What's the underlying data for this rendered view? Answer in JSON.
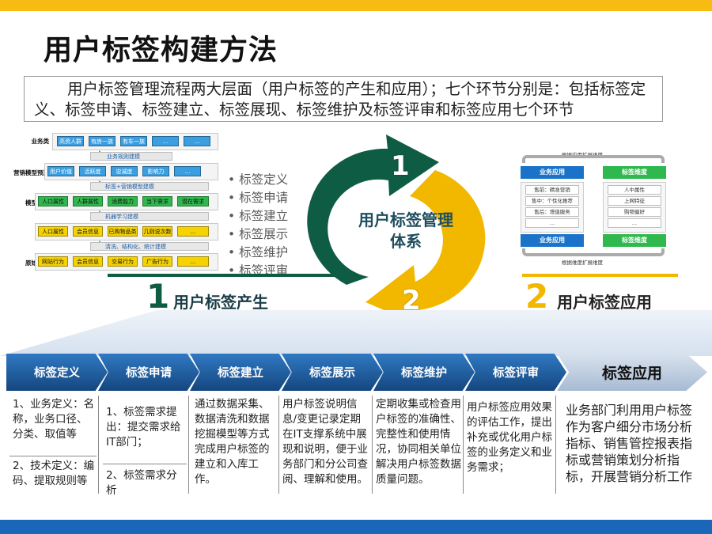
{
  "title": "用户标签构建方法",
  "intro": "用户标签管理流程两大层面（用户标签的产生和应用）；七个环节分别是：包括标签定义、标签申请、标签建立、标签展现、标签维护及标签评审和标签应用七个环节",
  "left_diagram": {
    "rows": [
      {
        "label": "业务类",
        "chips": [
          "高资人群",
          "有房一族",
          "有车一族",
          "...",
          "..."
        ],
        "color": "blue"
      },
      {
        "band": "业务规则建模"
      },
      {
        "label": "营销模型预测",
        "chips": [
          "用户价值",
          "活跃度",
          "忠诚度",
          "影响力",
          "..."
        ],
        "color": "blue"
      },
      {
        "band": "标签+营销模型建模"
      },
      {
        "label": "模型预测",
        "chips": [
          "人口属性",
          "人群属性",
          "消费能力",
          "当下需求",
          "潜在需求"
        ],
        "color": "green"
      },
      {
        "band": "机器学习建模"
      },
      {
        "label": "事实",
        "chips": [
          "人口属性",
          "会员信息",
          "已购物品类",
          "几则说次数",
          "..."
        ],
        "color": "yellow"
      },
      {
        "band": "清洗、结构化、统计建模"
      },
      {
        "label": "原始输入",
        "chips": [
          "网站行为",
          "会员信息",
          "交易行为",
          "广告行为",
          "..."
        ],
        "color": "yellow"
      }
    ]
  },
  "bullets": [
    "标签定义",
    "标签申请",
    "标签建立",
    "标签展示",
    "标签维护",
    "标签评审"
  ],
  "cycle": {
    "center": "用户标签管理体系",
    "num1": "1",
    "num2": "2"
  },
  "section1": {
    "num": "1",
    "label": "用户标签产生"
  },
  "section2": {
    "num": "2",
    "label": "用户标签应用"
  },
  "right_diagram": {
    "top_label": "根据应用扩展维度",
    "bottom_label": "根据维度扩展维度",
    "left_header": "业务应用",
    "right_header": "标签维度",
    "left_footer": "业务应用",
    "right_footer": "标签维度",
    "left_cells": [
      "售前：精准营销",
      "售中：个性化推荐",
      "售后：增值服务",
      "..."
    ],
    "right_cells": [
      "人中属性",
      "上网特征",
      "购物偏好",
      "..."
    ]
  },
  "colors": {
    "dark_green": "#0f5c44",
    "yellow": "#f2b800",
    "blue": "#1a66b8",
    "top_bar": "#f7bc12"
  },
  "stages": [
    "标签定义",
    "标签申请",
    "标签建立",
    "标签展示",
    "标签维护",
    "标签评审",
    "标签应用"
  ],
  "descriptions": {
    "def1": "1、业务定义：名称，业务口径、分类、取值等",
    "def2": "2、技术定义：编码、提取规则等",
    "apply1": "1、标签需求提出：提交需求给IT部门；",
    "apply2": "2、标签需求分析",
    "build": "通过数据采集、数据清洗和数据挖掘模型等方式完成用户标签的建立和入库工作。",
    "show": "用户标签说明信息/变更记录定期在IT支撑系统中展现和说明，便于业务部门和分公司查阅、理解和使用。",
    "maintain": "定期收集或检查用户标签的准确性、完整性和使用情况，协同相关单位解决用户标签数据质量问题。",
    "review": "用户标签应用效果的评估工作，提出补充或优化用户标签的业务定义和业务需求；",
    "application": "业务部门利用用户标签作为客户细分市场分析指标、销售管控报表指标或营销策划分析指标，开展营销分析工作"
  }
}
